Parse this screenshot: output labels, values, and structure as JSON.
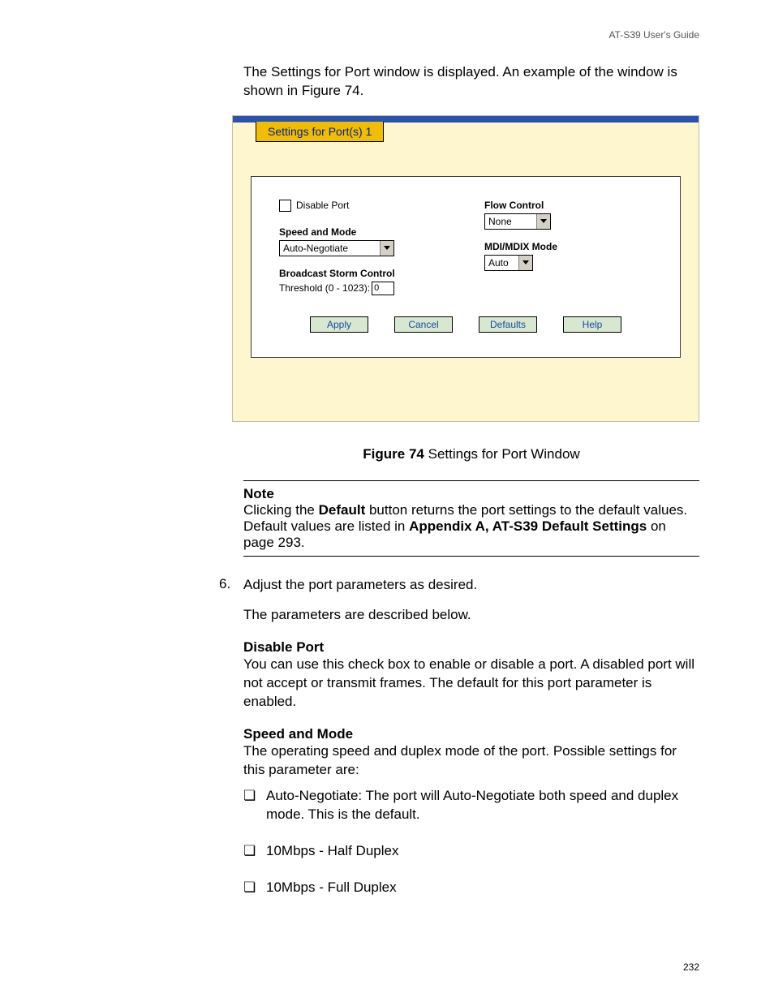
{
  "header": {
    "guide": "AT-S39 User's Guide"
  },
  "intro": {
    "p1": "The Settings for Port window is displayed. An example of the window is shown in Figure 74."
  },
  "window": {
    "tab_title": "Settings for Port(s) 1",
    "disable_port_label": "Disable Port",
    "speed_mode_label": "Speed and Mode",
    "speed_mode_value": "Auto-Negotiate",
    "bsc_label": "Broadcast Storm Control",
    "threshold_label": "Threshold (0 - 1023):",
    "threshold_value": "0",
    "flow_control_label": "Flow Control",
    "flow_control_value": "None",
    "mdi_label": "MDI/MDIX Mode",
    "mdi_value": "Auto",
    "buttons": {
      "apply": "Apply",
      "cancel": "Cancel",
      "defaults": "Defaults",
      "help": "Help"
    }
  },
  "figure_caption": {
    "bold": "Figure 74",
    "rest": "  Settings for Port Window"
  },
  "note": {
    "title": "Note",
    "pre": "Clicking the ",
    "b1": "Default",
    "mid": " button returns the port settings to the default values. Default values are listed in ",
    "b2": "Appendix A, AT-S39 Default Settings",
    "post": " on page 293."
  },
  "step": {
    "num": "6.",
    "line": "Adjust the port parameters as desired.",
    "line2": "The parameters are described below."
  },
  "disable_section": {
    "head": "Disable Port",
    "body": "You can use this check box to enable or disable a port. A disabled port will not accept or transmit frames. The default for this port parameter is enabled."
  },
  "speed_section": {
    "head": "Speed and Mode",
    "body": "The operating speed and duplex mode of the port. Possible settings for this parameter are:",
    "bullets": [
      "Auto-Negotiate: The port will Auto-Negotiate both speed and duplex mode. This is the default.",
      "10Mbps - Half Duplex",
      "10Mbps - Full Duplex"
    ]
  },
  "page_number": "232"
}
